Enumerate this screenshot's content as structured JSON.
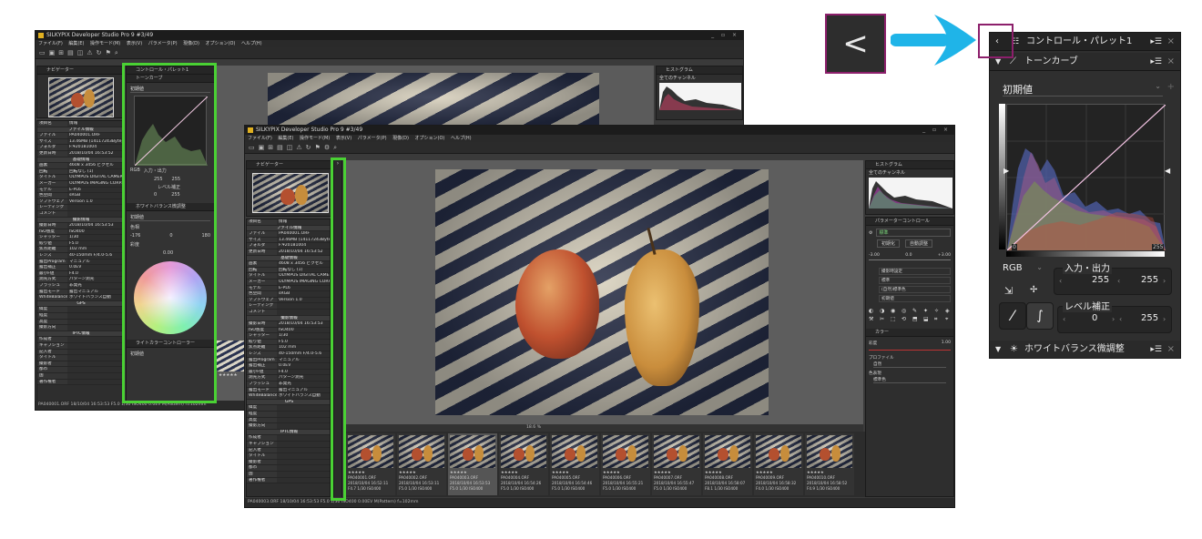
{
  "back_window": {
    "title": "SILKYPIX Developer Studio Pro 9   #3/49",
    "menu": [
      "ファイル(F)",
      "編集(E)",
      "操作モード(M)",
      "表示(V)",
      "パラメータ(P)",
      "現像(D)",
      "オプション(O)",
      "ヘルプ(H)"
    ],
    "window_controls": "_ ▫ ×",
    "navigator_title": "ナビゲーター",
    "control_palette_title": "コントロール・パレット1",
    "tone_curve_title": "トーンカーブ",
    "preset": "初期値",
    "channel": "RGB",
    "io_label": "入力・出力",
    "io_in": "255",
    "io_out": "255",
    "level_label": "レベル補正",
    "level_low": "0",
    "level_high": "255",
    "wb_title": "ホワイトバランス微調整",
    "wb_preset": "初期値",
    "temp_label": "色相",
    "temp_min": "-176",
    "temp_val": "0",
    "temp_max": "180",
    "sat_label": "彩度",
    "sat_val": "0.00",
    "light_title": "ライトカラーコントローラー",
    "light_preset": "初期値",
    "histogram_title": "ヒストグラム",
    "histogram_channel": "全てのチャンネル",
    "table": {
      "header": [
        "項目名",
        "情報"
      ],
      "rows": [
        [
          "",
          "ファイル情報"
        ],
        [
          "ファイル",
          "PA040001.ORF"
        ],
        [
          "サイズ",
          "13.46MB (14117243Byte)"
        ],
        [
          "フォルダ",
          "F:¥20181004"
        ],
        [
          "更新日時",
          "2018/10/04 16:53:52"
        ],
        [
          "",
          "基礎情報"
        ],
        [
          "画素",
          "4608 x 3456 ピクセル"
        ],
        [
          "回転",
          "回転なし (1)"
        ],
        [
          "タイトル",
          "OLYMPUS DIGITAL CAMERA"
        ],
        [
          "メーカー",
          "OLYMPUS IMAGING CORP."
        ],
        [
          "モデル",
          "E-PL6"
        ],
        [
          "色空間",
          "sRGB"
        ],
        [
          "ソフトウェア",
          "Version 1.0"
        ],
        [
          "レーティング",
          ""
        ],
        [
          "コメント",
          ""
        ],
        [
          "",
          "撮影情報"
        ],
        [
          "撮影日時",
          "2018/10/04 16:53:53"
        ],
        [
          "ISO感度",
          "ISO400"
        ],
        [
          "シャッター",
          "1/30"
        ],
        [
          "絞り値",
          "F5.0"
        ],
        [
          "焦点距離",
          "102 mm"
        ],
        [
          "レンズ",
          "40-150mm F/4.0-5.6"
        ],
        [
          "露出Program",
          "マニュアル"
        ],
        [
          "露出補正",
          "0.0EV"
        ],
        [
          "最小F値",
          "F4.0"
        ],
        [
          "測光方式",
          "パターン測光"
        ],
        [
          "フラッシュ",
          "非発光"
        ],
        [
          "露出モード",
          "露出マニュアル"
        ],
        [
          "WhiteBalance",
          "ホワイトバランス自動"
        ],
        [
          "",
          "GPS"
        ],
        [
          "緯度",
          ""
        ],
        [
          "経度",
          ""
        ],
        [
          "高度",
          ""
        ],
        [
          "撮影方向",
          ""
        ],
        [
          "",
          "IPTC情報"
        ],
        [
          "作成者",
          ""
        ],
        [
          "キャプション",
          ""
        ],
        [
          "記入者",
          ""
        ],
        [
          "タイトル",
          ""
        ],
        [
          "撮影者",
          ""
        ],
        [
          "都市",
          ""
        ],
        [
          "国",
          ""
        ],
        [
          "著作権者",
          ""
        ]
      ]
    },
    "status": "PA040001.ORF 18/10/04 16:53:53 F5.0 1/30 ISO400  0.0EV M(Pattern) f=102mm"
  },
  "front_window": {
    "title": "SILKYPIX Developer Studio Pro 9   #3/49",
    "menu": [
      "ファイル(F)",
      "編集(E)",
      "操作モード(M)",
      "表示(V)",
      "パラメータ(P)",
      "現像(D)",
      "オプション(O)",
      "ヘルプ(H)"
    ],
    "window_controls": "_ ▫ ×",
    "navigator_title": "ナビゲーター",
    "histogram_title": "ヒストグラム",
    "histogram_channel": "全てのチャンネル",
    "param_title": "パラメーターコントロール",
    "param_preset": "標準",
    "btn_init": "初期化",
    "btn_auto": "自動調整",
    "exposure_min": "-3.00",
    "exposure_val": "0.0",
    "exposure_max": "+3.00",
    "color_title": "カラー",
    "sat_label": "彩度",
    "sat_val": "1.00",
    "profile_label": "プロファイル",
    "profile_val": "自然",
    "colormode_label": "色表現",
    "colormode_val": "標準色",
    "param_rows": [
      "撮影時設定",
      "標準",
      "(自然)標準色",
      "初期値"
    ],
    "zoom_level": "18.6 %",
    "thumbs": [
      {
        "name": "PA040001.ORF",
        "date": "2018/10/04 16:52:11",
        "exif": "F4.7 1/30 ISO400",
        "stars": "★★★★★"
      },
      {
        "name": "PA040002.ORF",
        "date": "2018/10/04 16:53:11",
        "exif": "F5.0 1/30 ISO400",
        "stars": "★★★★★"
      },
      {
        "name": "PA040003.ORF",
        "date": "2018/10/04 16:53:53",
        "exif": "F5.0 1/30 ISO400",
        "stars": "★★★★★"
      },
      {
        "name": "PA040004.ORF",
        "date": "2018/10/04 16:54:26",
        "exif": "F5.0 1/30 ISO400",
        "stars": "★★★★★"
      },
      {
        "name": "PA040005.ORF",
        "date": "2018/10/04 16:54:46",
        "exif": "F5.0 1/30 ISO400",
        "stars": "★★★★★"
      },
      {
        "name": "PA040006.ORF",
        "date": "2018/10/04 16:55:21",
        "exif": "F5.0 1/30 ISO400",
        "stars": "★★★★★"
      },
      {
        "name": "PA040007.ORF",
        "date": "2018/10/04 16:55:47",
        "exif": "F5.0 1/30 ISO400",
        "stars": "★★★★★"
      },
      {
        "name": "PA040008.ORF",
        "date": "2018/10/04 16:58:07",
        "exif": "F8.1 1/30 ISO400",
        "stars": "★★★★★"
      },
      {
        "name": "PA040009.ORF",
        "date": "2018/10/04 16:58:32",
        "exif": "F4.0 1/30 ISO400",
        "stars": "★★★★★"
      },
      {
        "name": "PA040010.ORF",
        "date": "2018/10/04 16:58:52",
        "exif": "F4.9 1/30 ISO400",
        "stars": "★★★★★"
      }
    ],
    "status": "PA040003.ORF 18/10/04 16:53:53 F5.0 1/30 ISO400  0.00EV M(Pattern) f=102mm"
  },
  "zoom_panel": {
    "palette_title": "コントロール・パレット1",
    "tone_curve_title": "トーンカーブ",
    "preset": "初期値",
    "channel": "RGB",
    "io_label": "入力・出力",
    "io_in": "255",
    "io_out": "255",
    "level_label": "レベル補正",
    "level_low": "0",
    "level_high": "255",
    "wb_title": "ホワイトバランス微調整",
    "axis_min": "0",
    "axis_max": "255"
  },
  "back_button_glyph": "<",
  "arrow_color": "#1fb4e8",
  "highlight_green": "#4ad134",
  "highlight_magenta": "#8c1f6b"
}
